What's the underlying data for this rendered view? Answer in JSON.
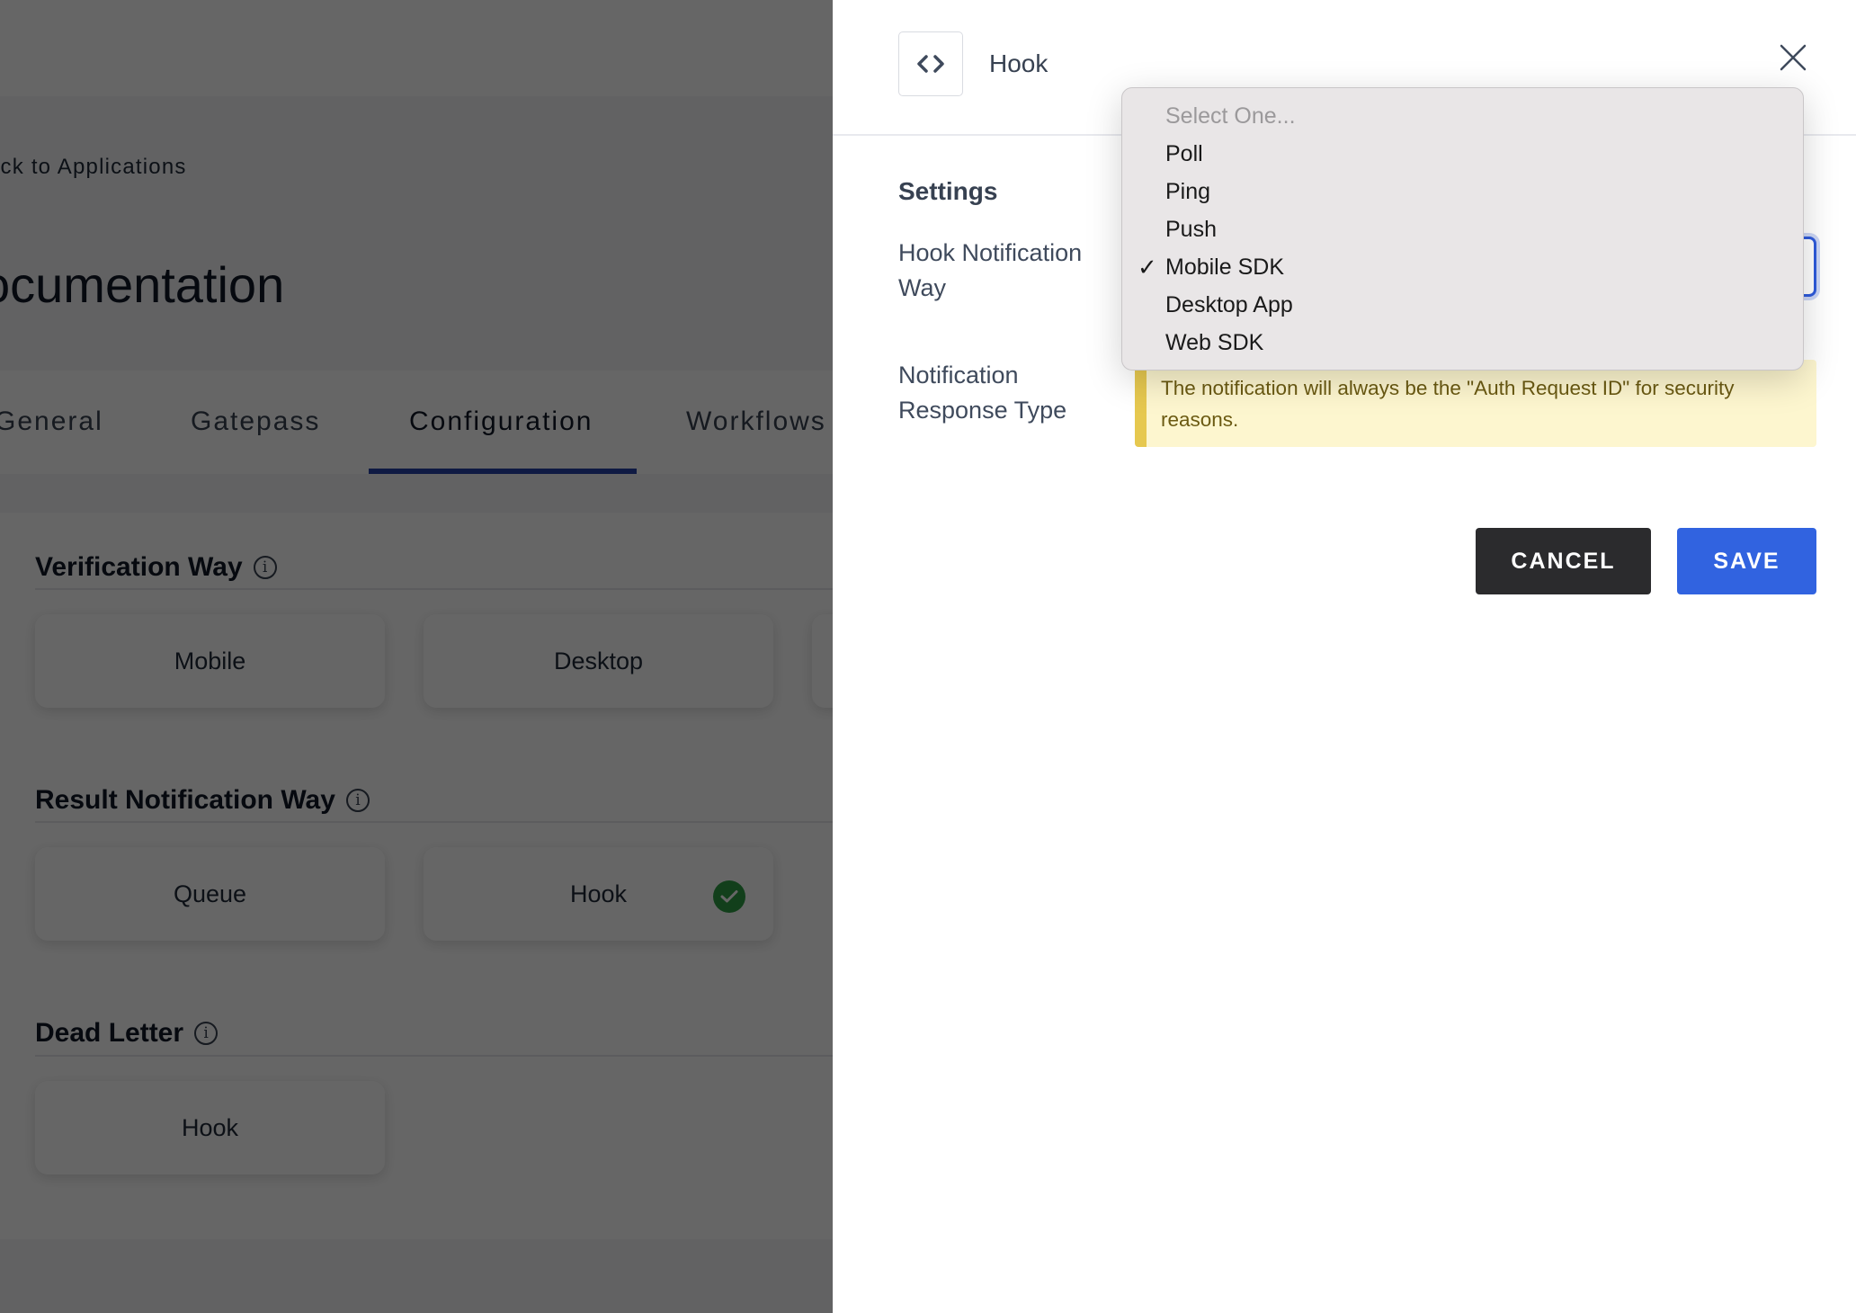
{
  "background_page": {
    "back_link": "ack to Applications",
    "title": "ocumentation",
    "tabs": [
      {
        "label": "General",
        "active": false
      },
      {
        "label": "Gatepass",
        "active": false
      },
      {
        "label": "Configuration",
        "active": true
      },
      {
        "label": "Workflows",
        "active": false
      }
    ],
    "sections": [
      {
        "title": "Verification Way",
        "options": [
          {
            "label": "Mobile",
            "selected": false
          },
          {
            "label": "Desktop",
            "selected": false
          },
          {
            "label": "",
            "selected": false
          }
        ]
      },
      {
        "title": "Result Notification Way",
        "options": [
          {
            "label": "Queue",
            "selected": false
          },
          {
            "label": "Hook",
            "selected": true
          }
        ]
      },
      {
        "title": "Dead Letter",
        "options": [
          {
            "label": "Hook",
            "selected": false
          }
        ]
      }
    ]
  },
  "drawer": {
    "icon": "code-brackets-icon",
    "title": "Hook",
    "close_icon": "close-icon",
    "settings_heading": "Settings",
    "fields": [
      {
        "label": "Hook Notification Way",
        "type": "select",
        "value": "Mobile SDK"
      },
      {
        "label": "Notification Response Type",
        "type": "notice",
        "notice": "The notification will always be the \"Auth Request ID\" for security reasons."
      }
    ],
    "cancel_label": "CANCEL",
    "save_label": "SAVE"
  },
  "dropdown": {
    "placeholder": "Select One...",
    "options": [
      {
        "label": "Poll",
        "selected": false
      },
      {
        "label": "Ping",
        "selected": false
      },
      {
        "label": "Push",
        "selected": false
      },
      {
        "label": "Mobile SDK",
        "selected": true
      },
      {
        "label": "Desktop App",
        "selected": false
      },
      {
        "label": "Web SDK",
        "selected": false
      }
    ],
    "check_glyph": "✓"
  },
  "colors": {
    "primary": "#3163e0",
    "cancel": "#2b2b2d",
    "tab_underline": "#2743a8",
    "notice_bg": "#fdf6cf",
    "notice_accent": "#e6c84f",
    "success": "#2f9e44"
  }
}
